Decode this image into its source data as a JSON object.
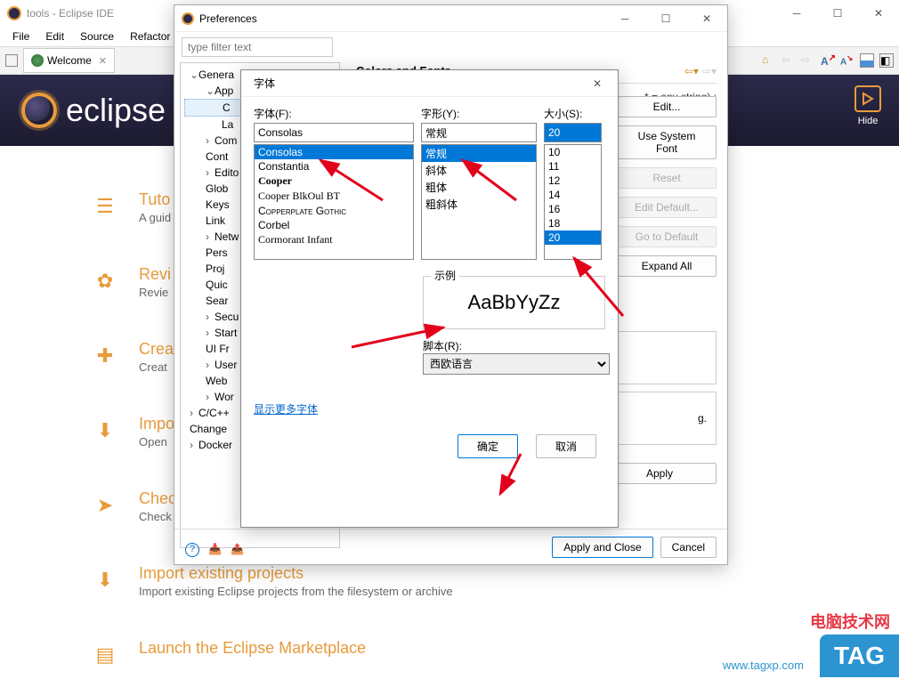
{
  "main_window": {
    "title": "tools - Eclipse IDE",
    "menu": [
      "File",
      "Edit",
      "Source",
      "Refactor"
    ],
    "welcome_tab": "Welcome",
    "banner_text": "eclipse",
    "hide_label": "Hide",
    "sections": {
      "tutorials": {
        "title": "Tuto",
        "desc": "A guid\nprojec"
      },
      "review": {
        "title": "Revi",
        "desc": "Revie"
      },
      "create": {
        "title": "Crea",
        "desc": "Creat"
      },
      "import": {
        "title": "Impo",
        "desc": "Open"
      },
      "checkout": {
        "title": "Chec",
        "desc": "Check"
      },
      "import_existing": {
        "title": "Import existing projects",
        "desc": "Import existing Eclipse projects from the filesystem or archive"
      },
      "marketplace": {
        "title": "Launch the Eclipse Marketplace"
      }
    }
  },
  "pref_dialog": {
    "title": "Preferences",
    "filter_placeholder": "type filter text",
    "page_title": "Colors and Fonts",
    "hint": "* = any string) :",
    "tree": {
      "general": "Genera",
      "app": "App",
      "items": [
        "C",
        "La",
        "Com",
        "Cont",
        "Edito",
        "Glob",
        "Keys",
        "Link",
        "Netw",
        "Pers",
        "Proj",
        "Quic",
        "Sear",
        "Secu",
        "Start",
        "UI Fr",
        "User",
        "Web",
        "Wor"
      ],
      "cpp": "C/C++",
      "change": "Change",
      "docker": "Docker"
    },
    "buttons": {
      "edit": "Edit...",
      "use_system": "Use System Font",
      "reset": "Reset",
      "edit_default": "Edit Default...",
      "go_default": "Go to Default",
      "expand_all": "Expand All",
      "apply": "Apply",
      "apply_close": "Apply and Close",
      "cancel": "Cancel"
    },
    "desc_text": "g."
  },
  "font_dialog": {
    "title": "字体",
    "labels": {
      "font": "字体(F):",
      "style": "字形(Y):",
      "size": "大小(S):",
      "sample": "示例",
      "script": "脚本(R):"
    },
    "font_value": "Consolas",
    "font_list": [
      "Consolas",
      "Constantia",
      "Cooper",
      "Cooper BlkOul BT",
      "Copperplate Gothic",
      "Corbel",
      "Cormorant Infant"
    ],
    "style_value": "常规",
    "style_list": [
      "常规",
      "斜体",
      "粗体",
      "粗斜体"
    ],
    "size_value": "20",
    "size_list": [
      "10",
      "11",
      "12",
      "14",
      "16",
      "18",
      "20"
    ],
    "sample_text": "AaBbYyZz",
    "script_value": "西欧语言",
    "more_fonts": "显示更多字体",
    "ok": "确定",
    "cancel_btn": "取消"
  },
  "watermark": {
    "line1": "电脑技术网",
    "line2": "www.tagxp.com",
    "tag": "TAG"
  },
  "chart_data": null
}
